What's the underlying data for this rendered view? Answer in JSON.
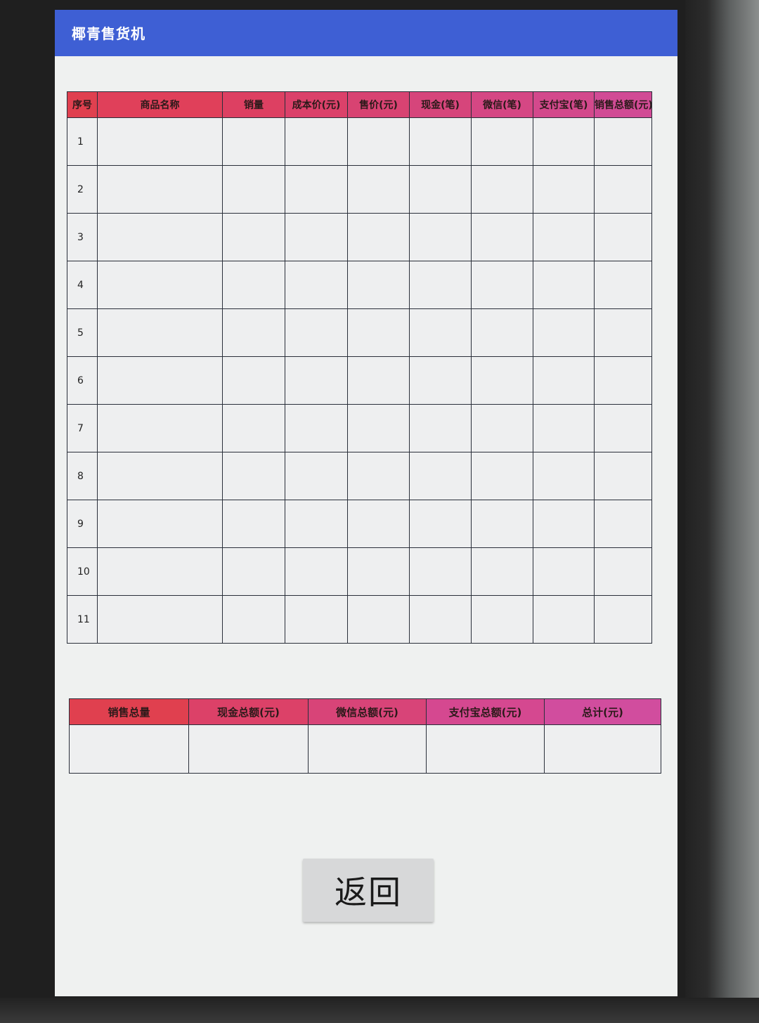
{
  "app": {
    "title": "椰青售货机"
  },
  "sales_table": {
    "headers": [
      "序号",
      "商品名称",
      "销量",
      "成本价(元)",
      "售价(元)",
      "现金(笔)",
      "微信(笔)",
      "支付宝(笔)",
      "销售总额(元)"
    ],
    "header_colors": [
      "#e0404f",
      "#e0405a",
      "#dd4062",
      "#db416a",
      "#d84372",
      "#d6457b",
      "#d54784",
      "#d3498c",
      "#d14b95"
    ],
    "rows": [
      [
        "1",
        "",
        "",
        "",
        "",
        "",
        "",
        "",
        ""
      ],
      [
        "2",
        "",
        "",
        "",
        "",
        "",
        "",
        "",
        ""
      ],
      [
        "3",
        "",
        "",
        "",
        "",
        "",
        "",
        "",
        ""
      ],
      [
        "4",
        "",
        "",
        "",
        "",
        "",
        "",
        "",
        ""
      ],
      [
        "5",
        "",
        "",
        "",
        "",
        "",
        "",
        "",
        ""
      ],
      [
        "6",
        "",
        "",
        "",
        "",
        "",
        "",
        "",
        ""
      ],
      [
        "7",
        "",
        "",
        "",
        "",
        "",
        "",
        "",
        ""
      ],
      [
        "8",
        "",
        "",
        "",
        "",
        "",
        "",
        "",
        ""
      ],
      [
        "9",
        "",
        "",
        "",
        "",
        "",
        "",
        "",
        ""
      ],
      [
        "10",
        "",
        "",
        "",
        "",
        "",
        "",
        "",
        ""
      ],
      [
        "11",
        "",
        "",
        "",
        "",
        "",
        "",
        "",
        ""
      ]
    ]
  },
  "summary_table": {
    "headers": [
      "销售总量",
      "现金总额(元)",
      "微信总额(元)",
      "支付宝总额(元)",
      "总计(元)"
    ],
    "header_colors": [
      "#e0404f",
      "#dc4168",
      "#d84478",
      "#d54890",
      "#d14d9e"
    ],
    "values": [
      "",
      "",
      "",
      "",
      ""
    ]
  },
  "buttons": {
    "back_label": "返回"
  }
}
